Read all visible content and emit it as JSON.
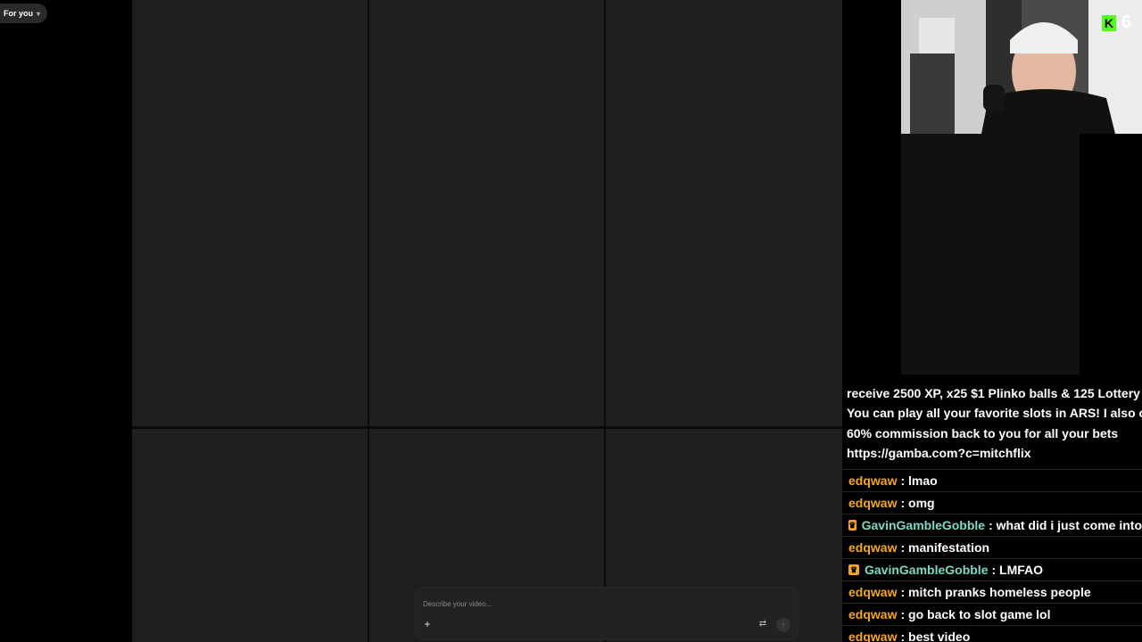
{
  "nav": {
    "for_you": "For you"
  },
  "prompt": {
    "placeholder": "Describe your video..."
  },
  "overlay": {
    "kick_count": "6"
  },
  "chat": {
    "bot_lines": [
      "receive 2500 XP, x25 $1 Plinko balls & 125 Lottery",
      "You can play all your favorite slots in ARS! I also o",
      "60% commission back to you for all your bets",
      "https://gamba.com?c=mitchflix"
    ],
    "messages": [
      {
        "user": "edqwaw",
        "text": "lmao",
        "badge": false
      },
      {
        "user": "edqwaw",
        "text": "omg",
        "badge": false
      },
      {
        "user": "GavinGambleGobble",
        "text": "what did i just come into",
        "badge": true
      },
      {
        "user": "edqwaw",
        "text": "manifestation",
        "badge": false
      },
      {
        "user": "GavinGambleGobble",
        "text": "LMFAO",
        "badge": true
      },
      {
        "user": "edqwaw",
        "text": "mitch pranks homeless people",
        "badge": false
      },
      {
        "user": "edqwaw",
        "text": "go back to slot game lol",
        "badge": false
      },
      {
        "user": "edqwaw",
        "text": "best video",
        "badge": false
      }
    ]
  },
  "colors": {
    "username": "#f5a623",
    "vip_username": "#7fd9c4",
    "kick_green": "#53fc18"
  }
}
